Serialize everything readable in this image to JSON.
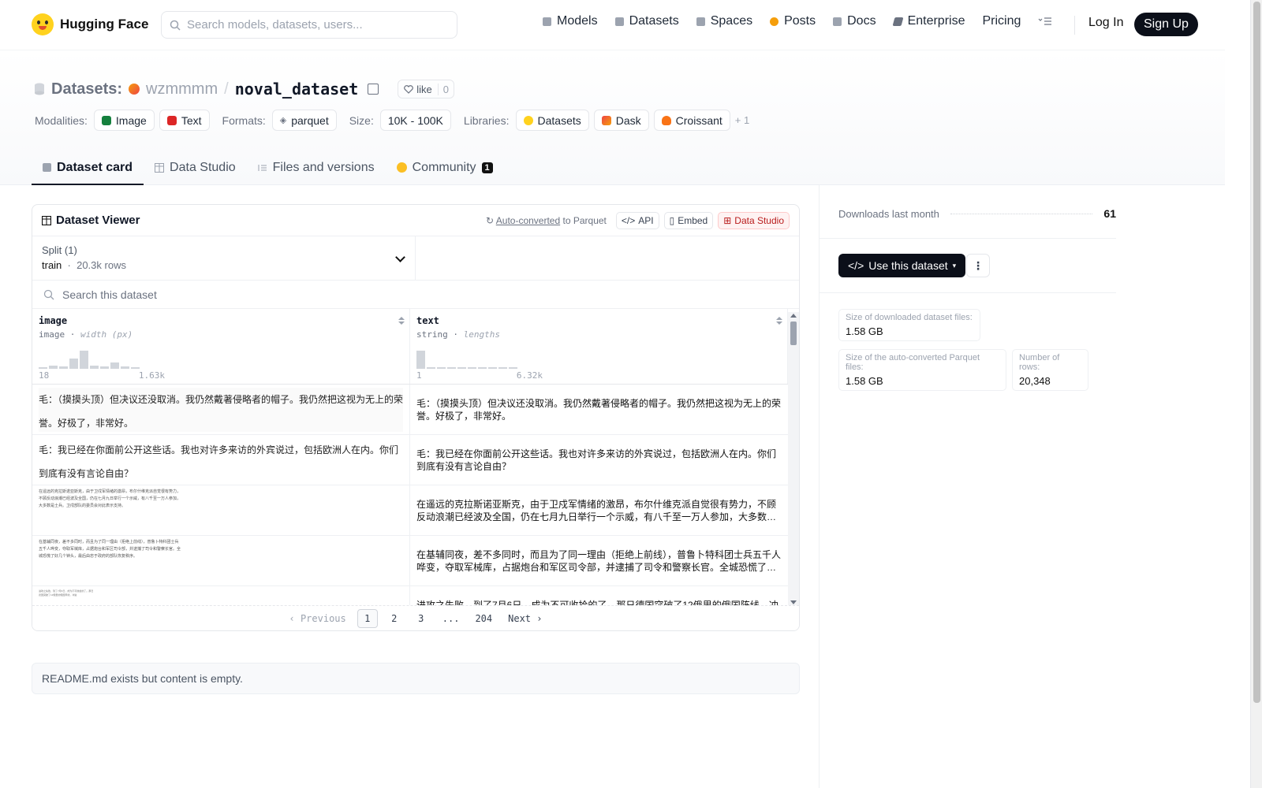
{
  "nav": {
    "brand": "Hugging Face",
    "search_placeholder": "Search models, datasets, users...",
    "links": [
      {
        "label": "Models",
        "icon": "models-icon",
        "color": "#9ca3af"
      },
      {
        "label": "Datasets",
        "icon": "datasets-icon",
        "color": "#9ca3af"
      },
      {
        "label": "Spaces",
        "icon": "spaces-icon",
        "color": "#9ca3af"
      },
      {
        "label": "Posts",
        "icon": "posts-icon",
        "color": "#f59e0b"
      },
      {
        "label": "Docs",
        "icon": "docs-icon",
        "color": "#9ca3af"
      },
      {
        "label": "Enterprise",
        "icon": "enterprise-icon",
        "color": "#6b7280"
      },
      {
        "label": "Pricing",
        "icon": "",
        "color": ""
      }
    ],
    "login": "Log In",
    "signup": "Sign Up"
  },
  "header": {
    "prefix": "Datasets:",
    "owner": "wzmmmm",
    "name": "noval_dataset",
    "like_label": "like",
    "like_count": "0",
    "modalities_label": "Modalities:",
    "modalities": [
      "Image",
      "Text"
    ],
    "formats_label": "Formats:",
    "formats": [
      "parquet"
    ],
    "size_label": "Size:",
    "size": "10K - 100K",
    "libraries_label": "Libraries:",
    "libraries": [
      "Datasets",
      "Dask",
      "Croissant"
    ],
    "libraries_more": "+ 1"
  },
  "tabs": [
    {
      "label": "Dataset card",
      "active": true
    },
    {
      "label": "Data Studio",
      "active": false
    },
    {
      "label": "Files and versions",
      "active": false
    },
    {
      "label": "Community",
      "active": false,
      "badge": "1"
    }
  ],
  "viewer": {
    "title": "Dataset Viewer",
    "auto_converted": "Auto-converted",
    "to_parquet": "to Parquet",
    "api": "API",
    "embed": "Embed",
    "data_studio": "Data Studio",
    "split_label": "Split (1)",
    "split_value": "train",
    "split_rows": "20.3k rows",
    "search_placeholder": "Search this dataset",
    "columns": [
      {
        "name": "image",
        "type": "image",
        "stat": "width (px)",
        "min": "18",
        "max": "1.63k",
        "hist": [
          0.08,
          0.15,
          0.12,
          0.5,
          0.9,
          0.15,
          0.1,
          0.3,
          0.12,
          0.05
        ]
      },
      {
        "name": "text",
        "type": "string",
        "stat": "lengths",
        "min": "1",
        "max": "6.32k",
        "hist": [
          0.9,
          0.06,
          0.05,
          0.04,
          0.03,
          0.0,
          0.05,
          0.0,
          0.0,
          0.05
        ]
      }
    ],
    "rows": [
      {
        "image_text": "毛：（摸摸头顶）但决议还没取消。我仍然戴著侵略者的帽子。我仍然把这视为无上的荣誉。好极了，非常好。",
        "image_kind": "large",
        "text": "毛：（摸摸头顶）但决议还没取消。我仍然戴著侵略者的帽子。我仍然把这视为无上的荣誉。好极了，非常好。"
      },
      {
        "image_text": "毛：我已经在你面前公开这些话。我也对许多来访的外宾说过，包括欧洲人在内。你们到底有没有言论自由？",
        "image_kind": "large",
        "text": "毛：我已经在你面前公开这些话。我也对许多来访的外宾说过，包括欧洲人在内。你们到底有没有言论自由？"
      },
      {
        "image_text": "在遥远的克拉斯诺亚斯克，由于卫戍军情绪的激昂，布尔什维克派自觉很有势力，不顾反动浪潮已经波及全国，仍在七月九日举行一个示威，有八千至一万人参加，大多数是士兵。卫戍部队的委员会对此表示支持。",
        "image_kind": "small",
        "text": "在遥远的克拉斯诺亚斯克，由于卫戍军情绪的激昂，布尔什维克派自觉很有势力，不顾反动浪潮已经波及全国，仍在七月九日举行一个示威，有八千至一万人参加，大多数是士兵。卫戍部队的委员会对此表示支持。"
      },
      {
        "image_text": "在基辅同夜，差不多同时，而且为了同一理由（拒绝上前线），普鲁卜特科团士兵五千人哗变，夺取军械库，占据炮台和军区司令部，并逮捕了司令和警察长官。全城恐慌了好几个钟头，最后由忠于政府的部队恢复秩序。",
        "image_kind": "small",
        "text": "在基辅同夜，差不多同时，而且为了同一理由（拒绝上前线），普鲁卜特科团士兵五千人哗变，夺取军械库，占据炮台和军区司令部，并逮捕了司令和警察长官。全城恐慌了好几个钟头，最后由忠于政府的部队恢复秩序。"
      },
      {
        "image_text": "进攻之失败，到了7月6日，成为不可收拾的了。那日德国突破了12俄里的俄国阵线，冲进",
        "image_kind": "tiny",
        "text": "进攻之失败，到了7月6日，成为不可收拾的了。那日德国突破了12俄里的俄国阵线，冲进"
      }
    ],
    "pager": {
      "previous": "Previous",
      "next": "Next",
      "pages": [
        "1",
        "2",
        "3",
        "...",
        "204"
      ],
      "active": "1"
    }
  },
  "readme": "README.md exists but content is empty.",
  "sidebar": {
    "downloads_label": "Downloads last month",
    "downloads_value": "61",
    "use_button": "Use this dataset",
    "stats": [
      {
        "label": "Size of downloaded dataset files:",
        "value": "1.58 GB"
      },
      {
        "label": "Size of the auto-converted Parquet files:",
        "value": "1.58 GB"
      },
      {
        "label": "Number of rows:",
        "value": "20,348"
      }
    ]
  }
}
